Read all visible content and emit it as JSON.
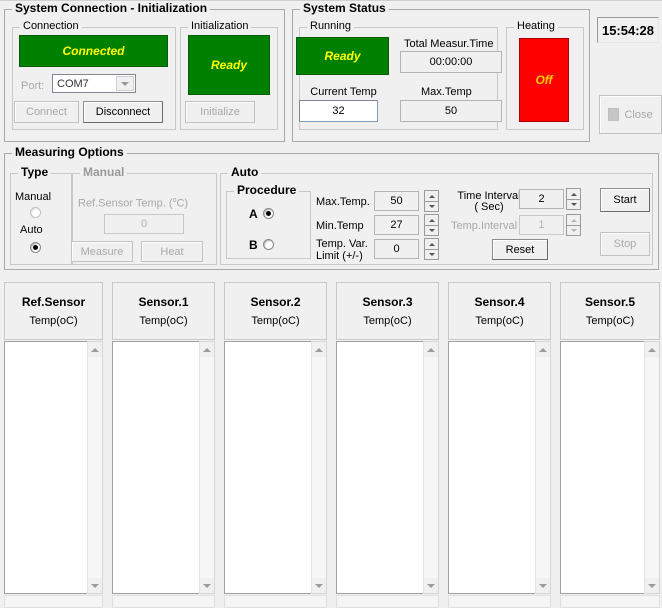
{
  "app": {
    "clock": "15:54:28",
    "close_label": "Close"
  },
  "system_connection": {
    "title": "System Connection - Initialization",
    "connection": {
      "caption": "Connection",
      "status": "Connected",
      "port_label": "Port:",
      "port_value": "COM7",
      "connect_label": "Connect",
      "disconnect_label": "Disconnect"
    },
    "initialization": {
      "caption": "Initialization",
      "status": "Ready",
      "initialize_label": "Initialize"
    }
  },
  "system_status": {
    "title": "System Status",
    "running": {
      "caption": "Running",
      "status": "Ready",
      "current_temp_label": "Current Temp",
      "current_temp_value": "32",
      "total_time_label": "Total Measur.Time",
      "total_time_value": "00:00:00",
      "max_temp_label": "Max.Temp",
      "max_temp_value": "50"
    },
    "heating": {
      "caption": "Heating",
      "status": "Off"
    }
  },
  "measuring_options": {
    "title": "Measuring Options",
    "type": {
      "caption": "Type",
      "manual_label": "Manual",
      "auto_label": "Auto",
      "selected": "Auto"
    },
    "manual": {
      "caption": "Manual",
      "ref_sensor_label": "Ref.Sensor Temp. (",
      "ref_sensor_unit": "o",
      "ref_sensor_unit2": "C)",
      "ref_sensor_value": "0",
      "measure_label": "Measure",
      "heat_label": "Heat"
    },
    "auto": {
      "caption": "Auto",
      "procedure": {
        "caption": "Procedure",
        "option_a": "A",
        "option_b": "B",
        "selected": "A"
      },
      "max_temp_label": "Max.Temp.",
      "max_temp_value": "50",
      "min_temp_label": "Min.Temp",
      "min_temp_value": "27",
      "temp_var_label_1": "Temp. Var.",
      "temp_var_label_2": "Limit  (+/-)",
      "temp_var_value": "0",
      "time_interval_label_1": "Time Interval",
      "time_interval_label_2": "( Sec)",
      "time_interval_value": "2",
      "temp_interval_label": "Temp.Interval",
      "temp_interval_value": "1",
      "reset_label": "Reset",
      "start_label": "Start",
      "stop_label": "Stop"
    }
  },
  "sensors": {
    "unit_label": "Temp(oC)",
    "columns": [
      {
        "name": "Ref.Sensor",
        "unit": "Temp(oC)",
        "values": []
      },
      {
        "name": "Sensor.1",
        "unit": "Temp(oC)",
        "values": []
      },
      {
        "name": "Sensor.2",
        "unit": "Temp(oC)",
        "values": []
      },
      {
        "name": "Sensor.3",
        "unit": "Temp(oC)",
        "values": []
      },
      {
        "name": "Sensor.4",
        "unit": "Temp(oC)",
        "values": []
      },
      {
        "name": "Sensor.5",
        "unit": "Temp(oC)",
        "values": []
      }
    ]
  },
  "colors": {
    "ok_green": "#008000",
    "status_text": "#ffff00",
    "alarm_red": "#ff0000",
    "window_bg": "#f0f0f0"
  }
}
